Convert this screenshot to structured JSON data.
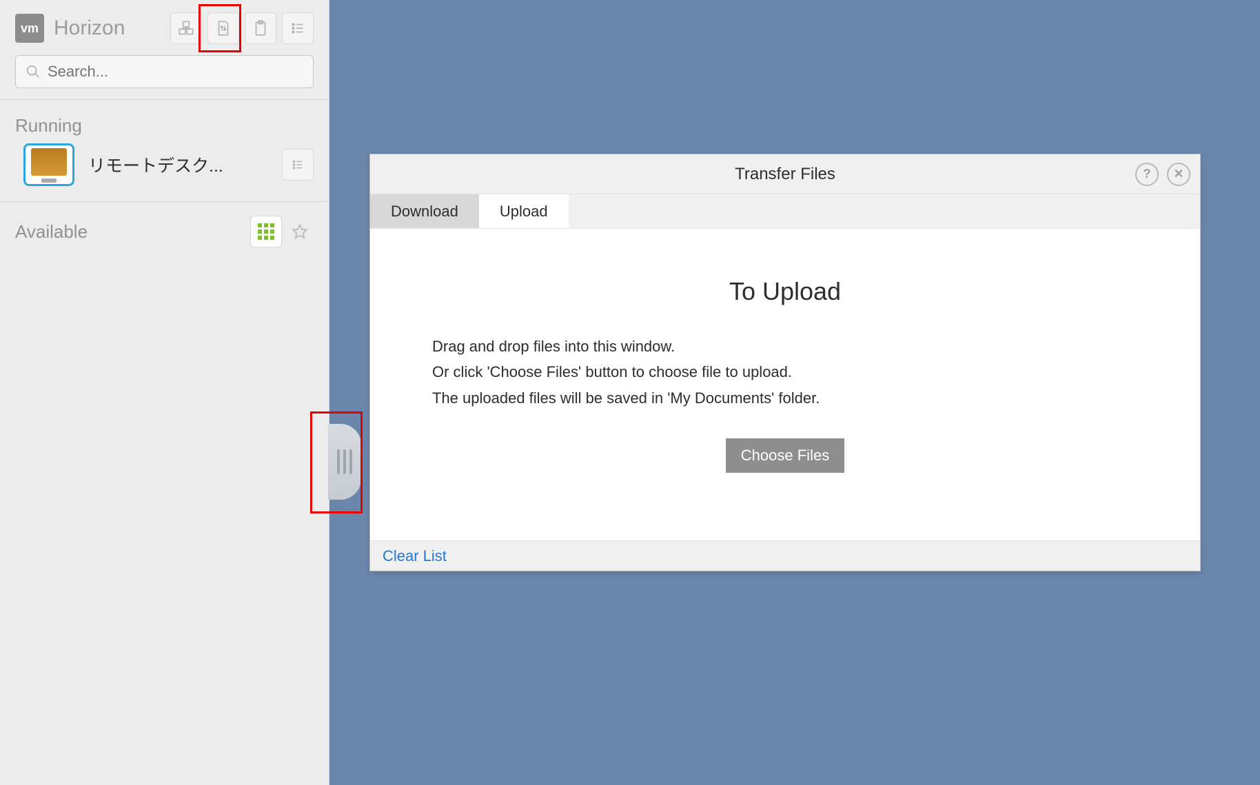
{
  "brand": {
    "logo_text": "vm",
    "name": "Horizon"
  },
  "search": {
    "placeholder": "Search..."
  },
  "sections": {
    "running": "Running",
    "available": "Available"
  },
  "running_item": {
    "label": "リモートデスク..."
  },
  "dialog": {
    "title": "Transfer Files",
    "tabs": {
      "download": "Download",
      "upload": "Upload"
    },
    "upload": {
      "heading": "To Upload",
      "line1": "Drag and drop files into this window.",
      "line2": "Or click 'Choose Files' button to choose file to upload.",
      "line3": "The uploaded files will be saved in 'My Documents' folder.",
      "choose_button": "Choose Files"
    },
    "footer": {
      "clear": "Clear List"
    }
  }
}
